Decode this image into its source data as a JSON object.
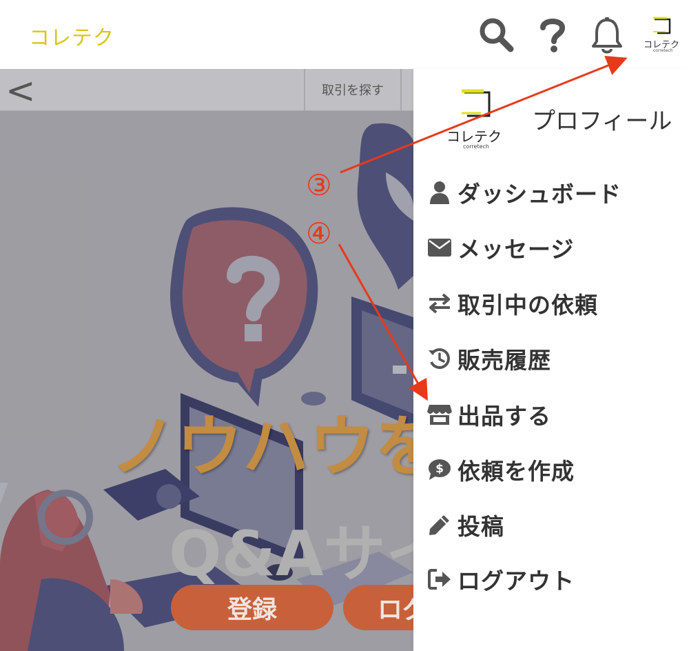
{
  "header": {
    "brand": "コレテク",
    "logo_text": "コレテク",
    "logo_subtext": "corretech"
  },
  "hero": {
    "back_glyph": "<",
    "find_tab": "取引を探す",
    "title": "ノウハウを",
    "subtitle": "Q&Aサイ",
    "register_button": "登録",
    "login_button": "ログ"
  },
  "menu": {
    "profile_label": "プロフィール",
    "profile_logo_text": "コレテク",
    "profile_logo_subtext": "corretech",
    "items": [
      {
        "label": "ダッシュボード",
        "icon": "user-icon"
      },
      {
        "label": "メッセージ",
        "icon": "envelope-icon"
      },
      {
        "label": "取引中の依頼",
        "icon": "exchange-icon"
      },
      {
        "label": "販売履歴",
        "icon": "history-icon"
      },
      {
        "label": "出品する",
        "icon": "store-icon"
      },
      {
        "label": "依頼を作成",
        "icon": "dollar-chat-icon"
      },
      {
        "label": "投稿",
        "icon": "pencil-icon"
      },
      {
        "label": "ログアウト",
        "icon": "sign-out-icon"
      }
    ]
  },
  "annotations": {
    "step3": "③",
    "step4": "④",
    "color": "#e8391a"
  },
  "colors": {
    "brand": "#d8c51a",
    "button": "#c8613b",
    "hero_title": "#c28c43",
    "icon": "#555555"
  }
}
